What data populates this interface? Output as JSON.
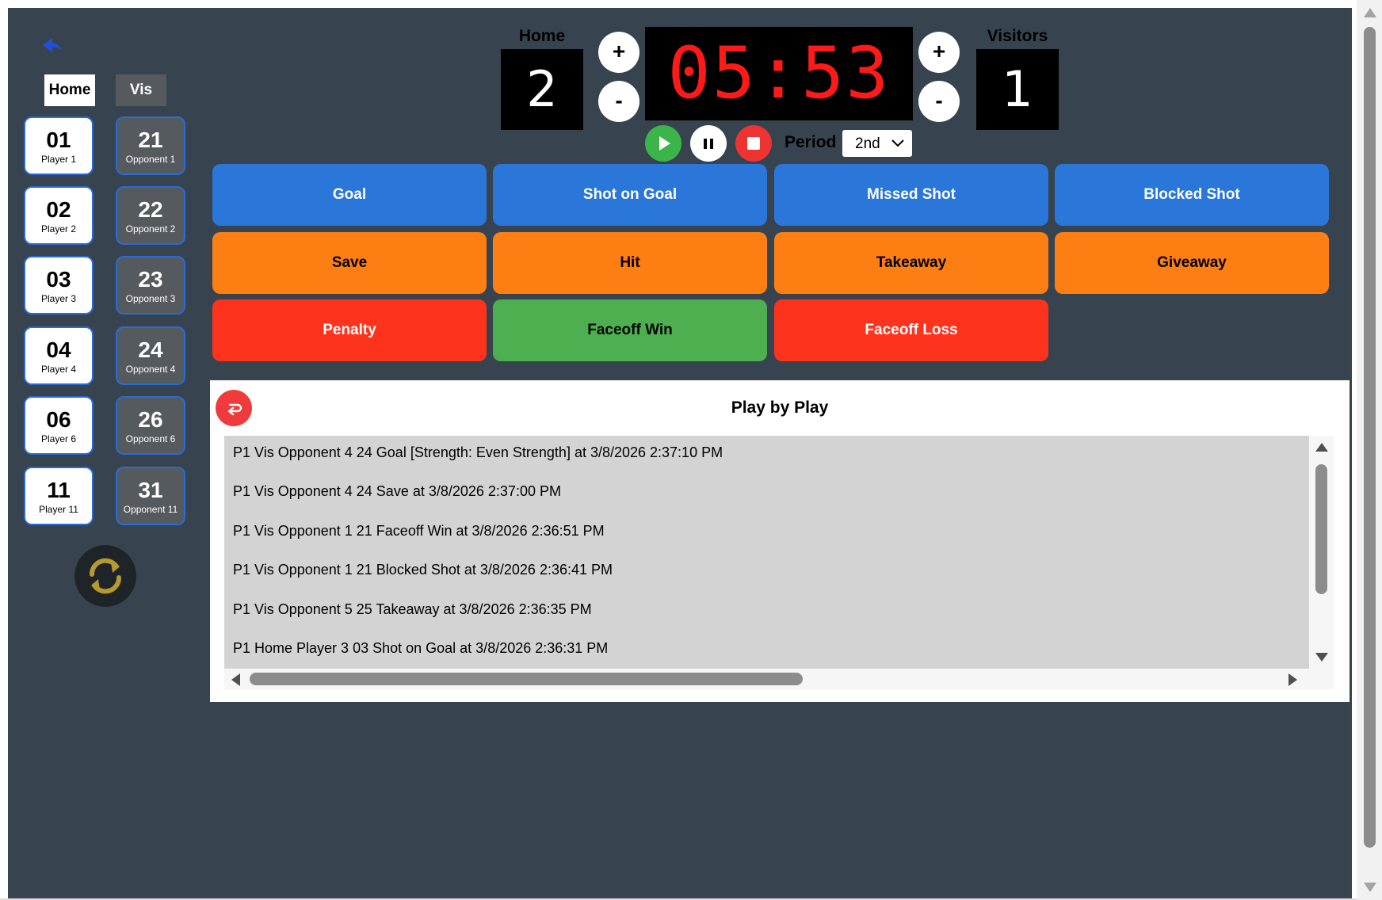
{
  "teams": {
    "home_tab": "Home",
    "vis_tab": "Vis"
  },
  "home_players": [
    {
      "number": "01",
      "name": "Player 1"
    },
    {
      "number": "02",
      "name": "Player 2"
    },
    {
      "number": "03",
      "name": "Player 3"
    },
    {
      "number": "04",
      "name": "Player 4"
    },
    {
      "number": "06",
      "name": "Player 6"
    },
    {
      "number": "11",
      "name": "Player 11"
    }
  ],
  "vis_players": [
    {
      "number": "21",
      "name": "Opponent 1"
    },
    {
      "number": "22",
      "name": "Opponent 2"
    },
    {
      "number": "23",
      "name": "Opponent 3"
    },
    {
      "number": "24",
      "name": "Opponent 4"
    },
    {
      "number": "26",
      "name": "Opponent 6"
    },
    {
      "number": "31",
      "name": "Opponent 11"
    }
  ],
  "scoreboard": {
    "home_label": "Home",
    "vis_label": "Visitors",
    "home_score": "2",
    "vis_score": "1",
    "clock": "05:53",
    "plus": "+",
    "minus": "-",
    "period_label": "Period",
    "period_value": "2nd"
  },
  "actions": {
    "goal": "Goal",
    "shot_on_goal": "Shot on Goal",
    "missed_shot": "Missed Shot",
    "blocked_shot": "Blocked Shot",
    "save": "Save",
    "hit": "Hit",
    "takeaway": "Takeaway",
    "giveaway": "Giveaway",
    "penalty": "Penalty",
    "faceoff_win": "Faceoff Win",
    "faceoff_loss": "Faceoff Loss"
  },
  "play_by_play": {
    "title": "Play by Play",
    "entries": [
      "P1 Vis Opponent 4 24 Goal [Strength: Even Strength] at 3/8/2026 2:37:10 PM",
      "P1 Vis Opponent 4 24 Save at 3/8/2026 2:37:00 PM",
      "P1 Vis Opponent 1 21 Faceoff Win at 3/8/2026 2:36:51 PM",
      "P1 Vis Opponent 1 21 Blocked Shot at 3/8/2026 2:36:41 PM",
      "P1 Vis Opponent 5 25 Takeaway at 3/8/2026 2:36:35 PM",
      "P1 Home Player 3 03 Shot on Goal at 3/8/2026 2:36:31 PM"
    ]
  },
  "icons": {
    "back": "back-arrow-icon",
    "refresh": "refresh-icon",
    "undo": "undo-icon",
    "play": "play-icon",
    "pause": "pause-icon",
    "stop": "stop-icon"
  },
  "colors": {
    "background": "#37444f",
    "blue_action": "#2a76d9",
    "orange_action": "#fd7f13",
    "red_action": "#fe331e",
    "green_action": "#4daf50",
    "clock_digits": "#ff1a1a"
  }
}
